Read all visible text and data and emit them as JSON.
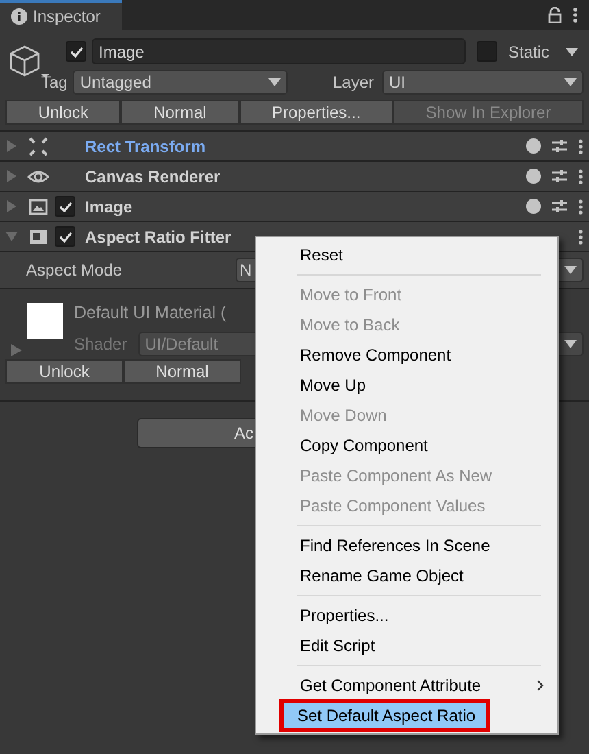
{
  "tab": {
    "title": "Inspector"
  },
  "object": {
    "active": true,
    "name": "Image",
    "static": false,
    "static_label": "Static",
    "tag_label": "Tag",
    "tag": "Untagged",
    "layer_label": "Layer",
    "layer": "UI"
  },
  "object_buttons": [
    {
      "label": "Unlock",
      "disabled": false
    },
    {
      "label": "Normal",
      "disabled": false
    },
    {
      "label": "Properties...",
      "disabled": false
    },
    {
      "label": "Show In Explorer",
      "disabled": true
    }
  ],
  "components": [
    {
      "kind": "rect",
      "name": "Rect Transform",
      "expanded": false,
      "highlighted": true
    },
    {
      "kind": "eye",
      "name": "Canvas Renderer",
      "expanded": false,
      "highlighted": false
    },
    {
      "kind": "image",
      "name": "Image",
      "expanded": false,
      "highlighted": false,
      "enabled": true
    },
    {
      "kind": "fitter",
      "name": "Aspect Ratio Fitter",
      "expanded": true,
      "highlighted": false,
      "enabled": true
    }
  ],
  "aspect_mode": {
    "label": "Aspect Mode",
    "value": "N"
  },
  "material": {
    "name": "Default UI Material (",
    "shader_label": "Shader",
    "shader": "UI/Default"
  },
  "material_buttons": [
    {
      "label": "Unlock"
    },
    {
      "label": "Normal"
    }
  ],
  "add_button": {
    "label": "Ac"
  },
  "context_menu": [
    {
      "kind": "item",
      "label": "Reset",
      "disabled": false,
      "selected": false
    },
    {
      "kind": "separator"
    },
    {
      "kind": "item",
      "label": "Move to Front",
      "disabled": true,
      "selected": false
    },
    {
      "kind": "item",
      "label": "Move to Back",
      "disabled": true,
      "selected": false
    },
    {
      "kind": "item",
      "label": "Remove Component",
      "disabled": false,
      "selected": false
    },
    {
      "kind": "item",
      "label": "Move Up",
      "disabled": false,
      "selected": false
    },
    {
      "kind": "item",
      "label": "Move Down",
      "disabled": true,
      "selected": false
    },
    {
      "kind": "item",
      "label": "Copy Component",
      "disabled": false,
      "selected": false
    },
    {
      "kind": "item",
      "label": "Paste Component As New",
      "disabled": true,
      "selected": false
    },
    {
      "kind": "item",
      "label": "Paste Component Values",
      "disabled": true,
      "selected": false
    },
    {
      "kind": "separator"
    },
    {
      "kind": "item",
      "label": "Find References In Scene",
      "disabled": false,
      "selected": false
    },
    {
      "kind": "item",
      "label": "Rename Game Object",
      "disabled": false,
      "selected": false
    },
    {
      "kind": "separator"
    },
    {
      "kind": "item",
      "label": "Properties...",
      "disabled": false,
      "selected": false
    },
    {
      "kind": "item",
      "label": "Edit Script",
      "disabled": false,
      "selected": false
    },
    {
      "kind": "separator"
    },
    {
      "kind": "submenu",
      "label": "Get Component Attribute",
      "disabled": false,
      "selected": false
    },
    {
      "kind": "item",
      "label": "Set Default Aspect Ratio",
      "disabled": false,
      "selected": true,
      "outlined": true
    }
  ]
}
